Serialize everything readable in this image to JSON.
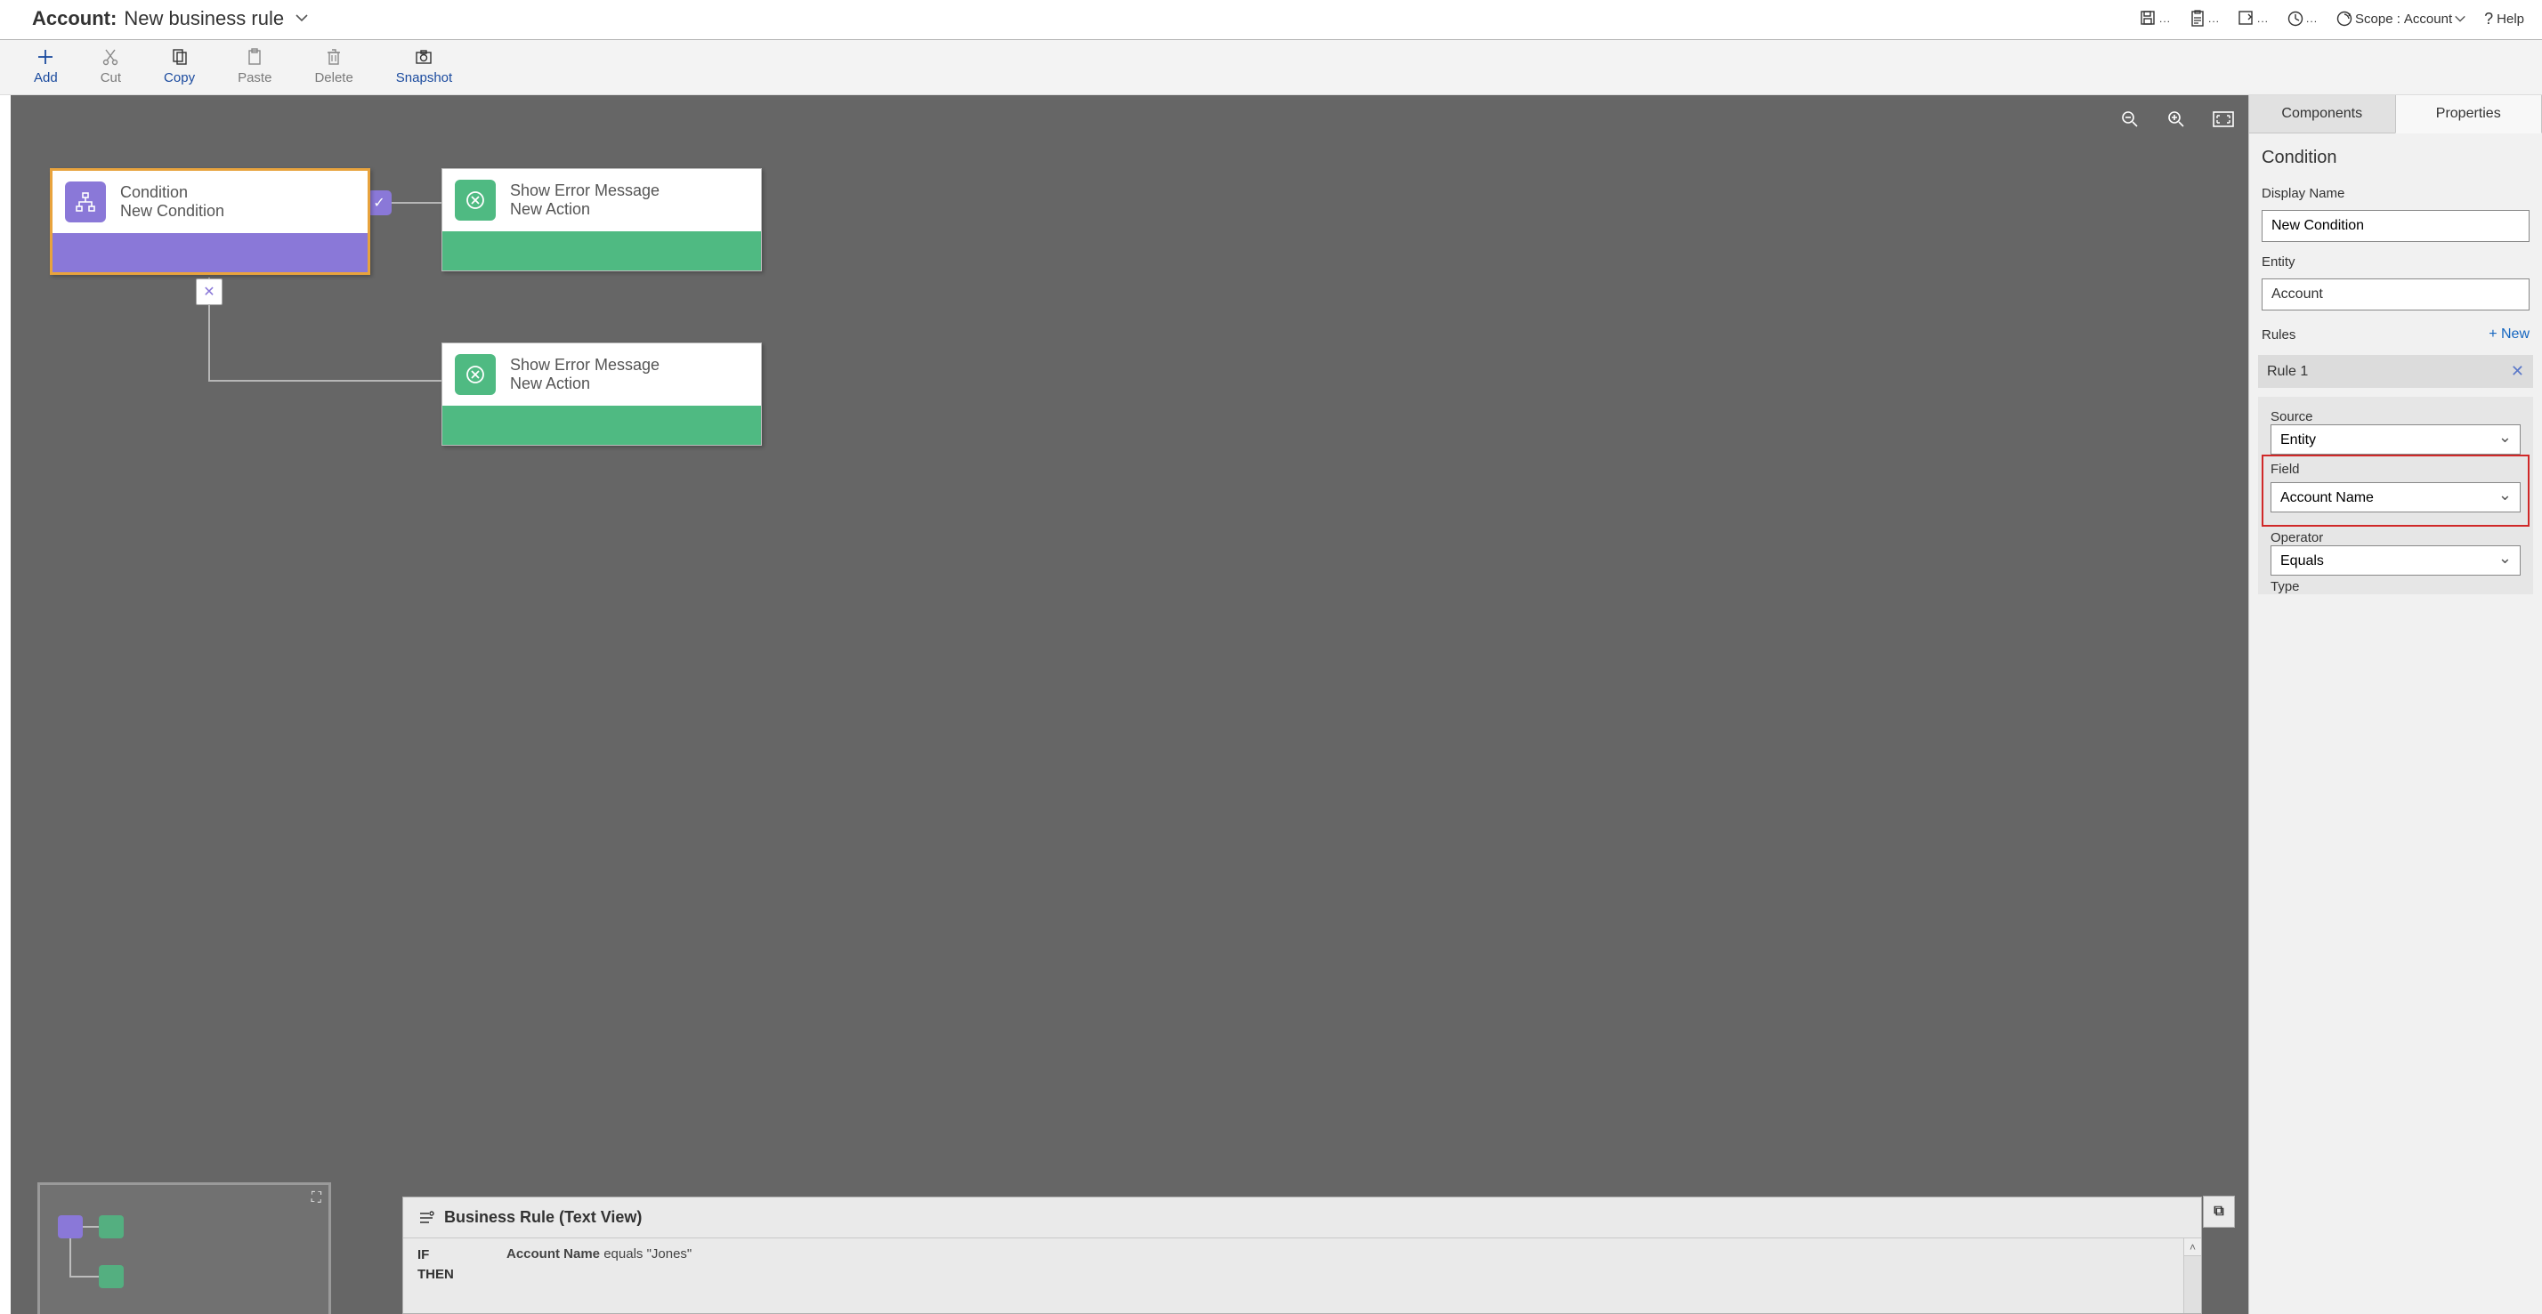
{
  "titlebar": {
    "entity": "Account:",
    "ruleName": "New business rule",
    "scopeLabel": "Scope :",
    "scopeValue": "Account",
    "help": "Help"
  },
  "toolbar": {
    "add": "Add",
    "cut": "Cut",
    "copy": "Copy",
    "paste": "Paste",
    "delete": "Delete",
    "snapshot": "Snapshot"
  },
  "canvas": {
    "conditionNode": {
      "title": "Condition",
      "subtitle": "New Condition"
    },
    "action1": {
      "title": "Show Error Message",
      "subtitle": "New Action"
    },
    "action2": {
      "title": "Show Error Message",
      "subtitle": "New Action"
    }
  },
  "textview": {
    "title": "Business Rule (Text View)",
    "if": "IF",
    "then": "THEN",
    "cond_field": "Account Name",
    "cond_rest": " equals \"Jones\""
  },
  "panel": {
    "tabComponents": "Components",
    "tabProperties": "Properties",
    "section": "Condition",
    "displayNameLabel": "Display Name",
    "displayNameValue": "New Condition",
    "entityLabel": "Entity",
    "entityValue": "Account",
    "rulesLabel": "Rules",
    "newLabel": "+  New",
    "rule1": "Rule 1",
    "sourceLabel": "Source",
    "sourceValue": "Entity",
    "fieldLabel": "Field",
    "fieldValue": "Account Name",
    "operatorLabel": "Operator",
    "operatorValue": "Equals",
    "typeLabel": "Type"
  }
}
